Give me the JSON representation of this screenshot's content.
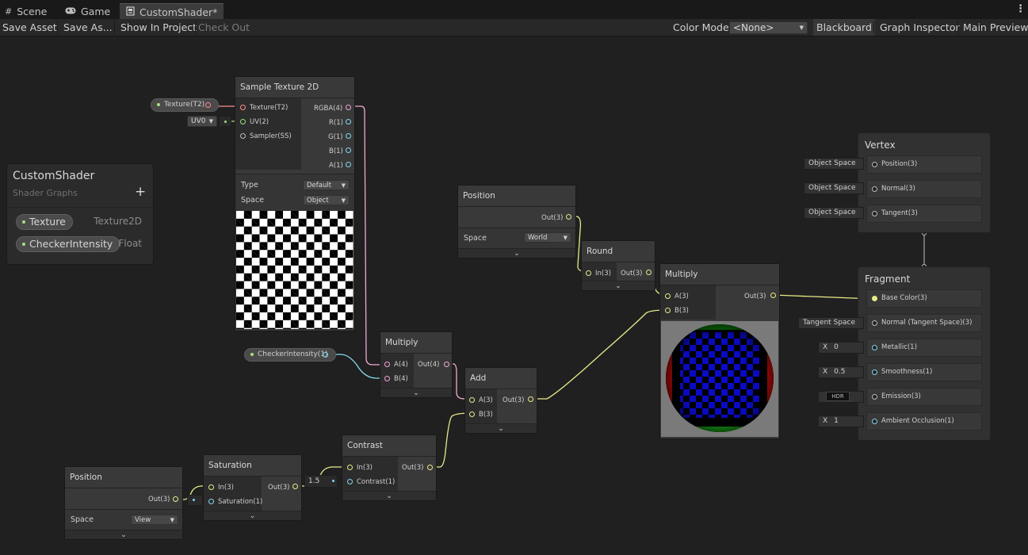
{
  "tabs": [
    {
      "label": "Scene",
      "icon": "grid-icon"
    },
    {
      "label": "Game",
      "icon": "gamepad-icon"
    },
    {
      "label": "CustomShader*",
      "icon": "shader-graph-icon"
    }
  ],
  "more_menu": "⋮",
  "toolbar": {
    "save_asset": "Save Asset",
    "save_as": "Save As...",
    "show_in_project": "Show In Project",
    "check_out": "Check Out",
    "color_mode_label": "Color Mode",
    "color_mode_value": "<None>",
    "blackboard": "Blackboard",
    "graph_inspector": "Graph Inspector",
    "main_preview": "Main Preview"
  },
  "blackboard": {
    "title": "CustomShader",
    "subtitle": "Shader Graphs",
    "add": "+",
    "properties": [
      {
        "name": "Texture",
        "type": "Texture2D"
      },
      {
        "name": "CheckerIntensity",
        "type": "Float"
      }
    ]
  },
  "nodes": {
    "sample_texture": {
      "title": "Sample Texture 2D",
      "inputs": [
        "Texture(T2)",
        "UV(2)",
        "Sampler(SS)"
      ],
      "outputs": [
        "RGBA(4)",
        "R(1)",
        "G(1)",
        "B(1)",
        "A(1)"
      ],
      "type_label": "Type",
      "type_value": "Default",
      "space_label": "Space",
      "space_value": "Object"
    },
    "position_top": {
      "title": "Position",
      "output": "Out(3)",
      "space_label": "Space",
      "space_value": "World"
    },
    "round": {
      "title": "Round",
      "input": "In(3)",
      "output": "Out(3)"
    },
    "multiply_main": {
      "title": "Multiply",
      "inputs": [
        "A(3)",
        "B(3)"
      ],
      "output": "Out(3)"
    },
    "multiply_small": {
      "title": "Multiply",
      "inputs": [
        "A(4)",
        "B(4)"
      ],
      "output": "Out(4)"
    },
    "add": {
      "title": "Add",
      "inputs": [
        "A(3)",
        "B(3)"
      ],
      "output": "Out(3)"
    },
    "contrast": {
      "title": "Contrast",
      "inputs": [
        "In(3)",
        "Contrast(1)"
      ],
      "output": "Out(3)",
      "contrast_value": "1.5"
    },
    "saturation": {
      "title": "Saturation",
      "inputs": [
        "In(3)",
        "Saturation(1)"
      ],
      "output": "Out(3)"
    },
    "position_bottom": {
      "title": "Position",
      "output": "Out(3)",
      "space_label": "Space",
      "space_value": "View"
    }
  },
  "property_nodes": {
    "texture": "Texture(T2)",
    "checker": "CheckerIntensity(1)",
    "uv": "UV0"
  },
  "vertex": {
    "title": "Vertex",
    "slots": [
      {
        "label": "Position(3)",
        "default": "Object Space"
      },
      {
        "label": "Normal(3)",
        "default": "Object Space"
      },
      {
        "label": "Tangent(3)",
        "default": "Object Space"
      }
    ]
  },
  "fragment": {
    "title": "Fragment",
    "slots": [
      {
        "label": "Base Color(3)",
        "default": ""
      },
      {
        "label": "Normal (Tangent Space)(3)",
        "default": "Tangent Space"
      },
      {
        "label": "Metallic(1)",
        "prefix": "X",
        "default": "0"
      },
      {
        "label": "Smoothness(1)",
        "prefix": "X",
        "default": "0.5"
      },
      {
        "label": "Emission(3)",
        "default": "HDR"
      },
      {
        "label": "Ambient Occlusion(1)",
        "prefix": "X",
        "default": "1"
      }
    ]
  },
  "colors": {
    "vector3_port": "#e8ea8a",
    "vector4_port": "#f0a8d0",
    "float_port": "#84d6f0",
    "texture_port": "#ff8b8b",
    "sampler_port": "#9e9e9e",
    "property_dot": "#a6e27a"
  }
}
